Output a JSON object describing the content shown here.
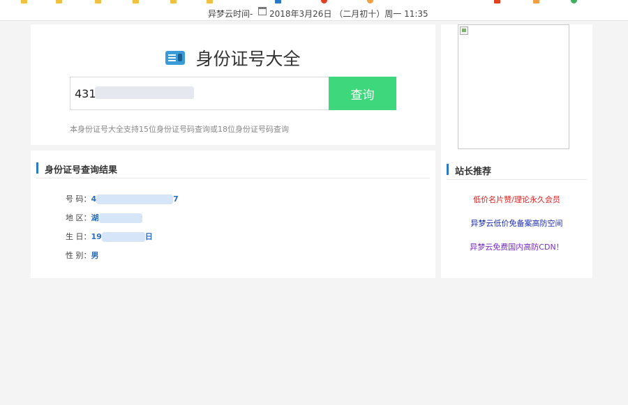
{
  "topbar": {
    "time_label": "异梦云时间-",
    "date_text": "2018年3月26日 （二月初十）周一 11:35"
  },
  "search": {
    "title": "身份证号大全",
    "input_value": "431",
    "button_label": "查询",
    "hint": "本身份证号大全支持15位身份证号码查询或18位身份证号码查询"
  },
  "result": {
    "heading": "身份证号查询结果",
    "rows": [
      {
        "label": "号 码：",
        "value_start": "4",
        "value_end": "7"
      },
      {
        "label": "地 区：",
        "value_start": "湖",
        "value_end": ""
      },
      {
        "label": "生 日：",
        "value_start": "19",
        "value_end": "日"
      },
      {
        "label": "性 别：",
        "value_start": "男",
        "value_end": ""
      }
    ]
  },
  "sidebar": {
    "heading": "站长推荐",
    "links": [
      {
        "text": "低价名片赞/理论永久会员",
        "color": "#e02020"
      },
      {
        "text": "异梦云低价免备案高防空间",
        "color": "#1a2bb0"
      },
      {
        "text": "异梦云免费国内高防CDN！",
        "color": "#7a2bc2"
      }
    ]
  },
  "colors": {
    "accent_button": "#3fd77b",
    "section_bar": "#2a79c8",
    "result_value": "#2a6db8"
  }
}
